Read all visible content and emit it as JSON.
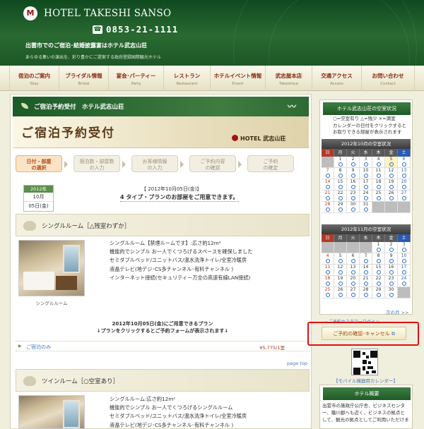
{
  "header": {
    "logo_mark": "M",
    "hotel_name": "HOTEL TAKESHI SANSO",
    "phone": "0853-21-1111",
    "tagline": "出雲市でのご宿泊･結婚披露宴はホテル武志山荘",
    "subtagline": "あらゆる集いの演出を、彩り豊かにご提案する政府登録国際観光ホテル"
  },
  "nav": [
    {
      "jp": "宿泊のご案内",
      "en": "Stay"
    },
    {
      "jp": "ブライダル情報",
      "en": "Bridal"
    },
    {
      "jp": "宴会･パーティー",
      "en": "Party"
    },
    {
      "jp": "レストラン",
      "en": "Restaurant"
    },
    {
      "jp": "ホテルイベント情報",
      "en": "Event"
    },
    {
      "jp": "武志屋本店",
      "en": "Takeshiya"
    },
    {
      "jp": "交通アクセス",
      "en": "Access"
    },
    {
      "jp": "お問い合わせ",
      "en": "Contact"
    }
  ],
  "banner": {
    "top_label": "ご宿泊予約受付　ホテル武志山荘",
    "title": "ご宿泊予約受付",
    "logo": "HOTEL 武志山荘"
  },
  "steps": [
    {
      "line1": "日付・部屋",
      "line2": "の選択",
      "active": true
    },
    {
      "line1": "宿泊数・部屋数",
      "line2": "の入力",
      "active": false
    },
    {
      "line1": "お客様情報",
      "line2": "の入力",
      "active": false
    },
    {
      "line1": "ご予約内容",
      "line2": "の確認",
      "active": false
    },
    {
      "line1": "ご予約",
      "line2": "の確定",
      "active": false
    }
  ],
  "selected_date": {
    "year": "2012年",
    "month": "10月",
    "day": "05日(金)"
  },
  "announcement": {
    "date_line": "【 2012年10月05日(金)】",
    "text": "4 タイプ・プランのお部屋をご用意できます。"
  },
  "rooms": [
    {
      "title": "シングルルーム［△残室わずか］",
      "photo_caption": "シングルルーム",
      "lines": [
        "シングルルーム【禁煙ルームです】:広さ約12m²",
        "機能的でシンプル お一人でくつろげるスペースを確保しました",
        "セミダブルベッド/ユニットバス/温水洗浄トイレ/全室冷暖房",
        "液晶テレビ(地デジ･CS多チャンネル･有料チャンネル )",
        "インターネット接続(セキュリティー万全の高速有線LAN接続)"
      ],
      "note_line1": "2012年10月05日(金)にご用意できるプラン",
      "note_line2": "↓プランをクリックするとご予約フォームが表示されます↓",
      "plan_name": "ご宿泊のみ",
      "plan_price": "¥5,775/1室"
    },
    {
      "title": "ツインルーム［○空室あり］",
      "lines": [
        "シングルルーム:広さ約12m²",
        "機能的でシンプル お一人でくつろげるシングルルーム",
        "セミダブルベッド/ユニットバス/温水洗浄トイレ/全室冷暖房",
        "液晶テレビ(地デジ･CS多チャンネル･有料チャンネル )"
      ]
    }
  ],
  "page_top": "page top",
  "sidebar": {
    "availability_title": "ホテル武志山荘の空室状況",
    "legend": [
      "○=空室有り △=残少 ×=満室",
      "カレンダーの日付をクリックすると",
      "お取りできる部屋が表示されます"
    ],
    "weekdays": [
      "日",
      "月",
      "火",
      "水",
      "木",
      "金",
      "土"
    ],
    "cal_oct_title": "2012年10月の空室状況",
    "cal_oct_rows": [
      [
        "",
        "1",
        "2",
        "3",
        "4",
        "5",
        "6"
      ],
      [
        "7",
        "8",
        "9",
        "10",
        "11",
        "12",
        "13"
      ],
      [
        "14",
        "15",
        "16",
        "17",
        "18",
        "19",
        "20"
      ],
      [
        "21",
        "22",
        "23",
        "24",
        "25",
        "26",
        "27"
      ],
      [
        "28",
        "29",
        "30",
        "31",
        "",
        "",
        ""
      ]
    ],
    "cal_nov_title": "2012年11月の空室状況",
    "cal_nov_rows": [
      [
        "",
        "",
        "",
        "",
        "1",
        "2",
        "3"
      ],
      [
        "4",
        "5",
        "6",
        "7",
        "8",
        "9",
        "10"
      ],
      [
        "11",
        "12",
        "13",
        "14",
        "15",
        "16",
        "17"
      ],
      [
        "18",
        "19",
        "20",
        "21",
        "22",
        "23",
        "24"
      ],
      [
        "25",
        "26",
        "27",
        "28",
        "29",
        "30",
        ""
      ]
    ],
    "next_month": "次の月 >>",
    "login_line": "→ ご予約カスタマーログイン",
    "confirm_button": "ご予約の確認･キャンセル",
    "mobile_link": "【モバイル機器用カレンダー】",
    "about_title": "ホテル概要",
    "about_lines": [
      "出雲市の施政庁公庁舎、ビジネスセンタ",
      "ー、簸川郡へも近く、ビジネスの拠点と",
      "して、観光の拠点としてご利用いただけま"
    ]
  }
}
